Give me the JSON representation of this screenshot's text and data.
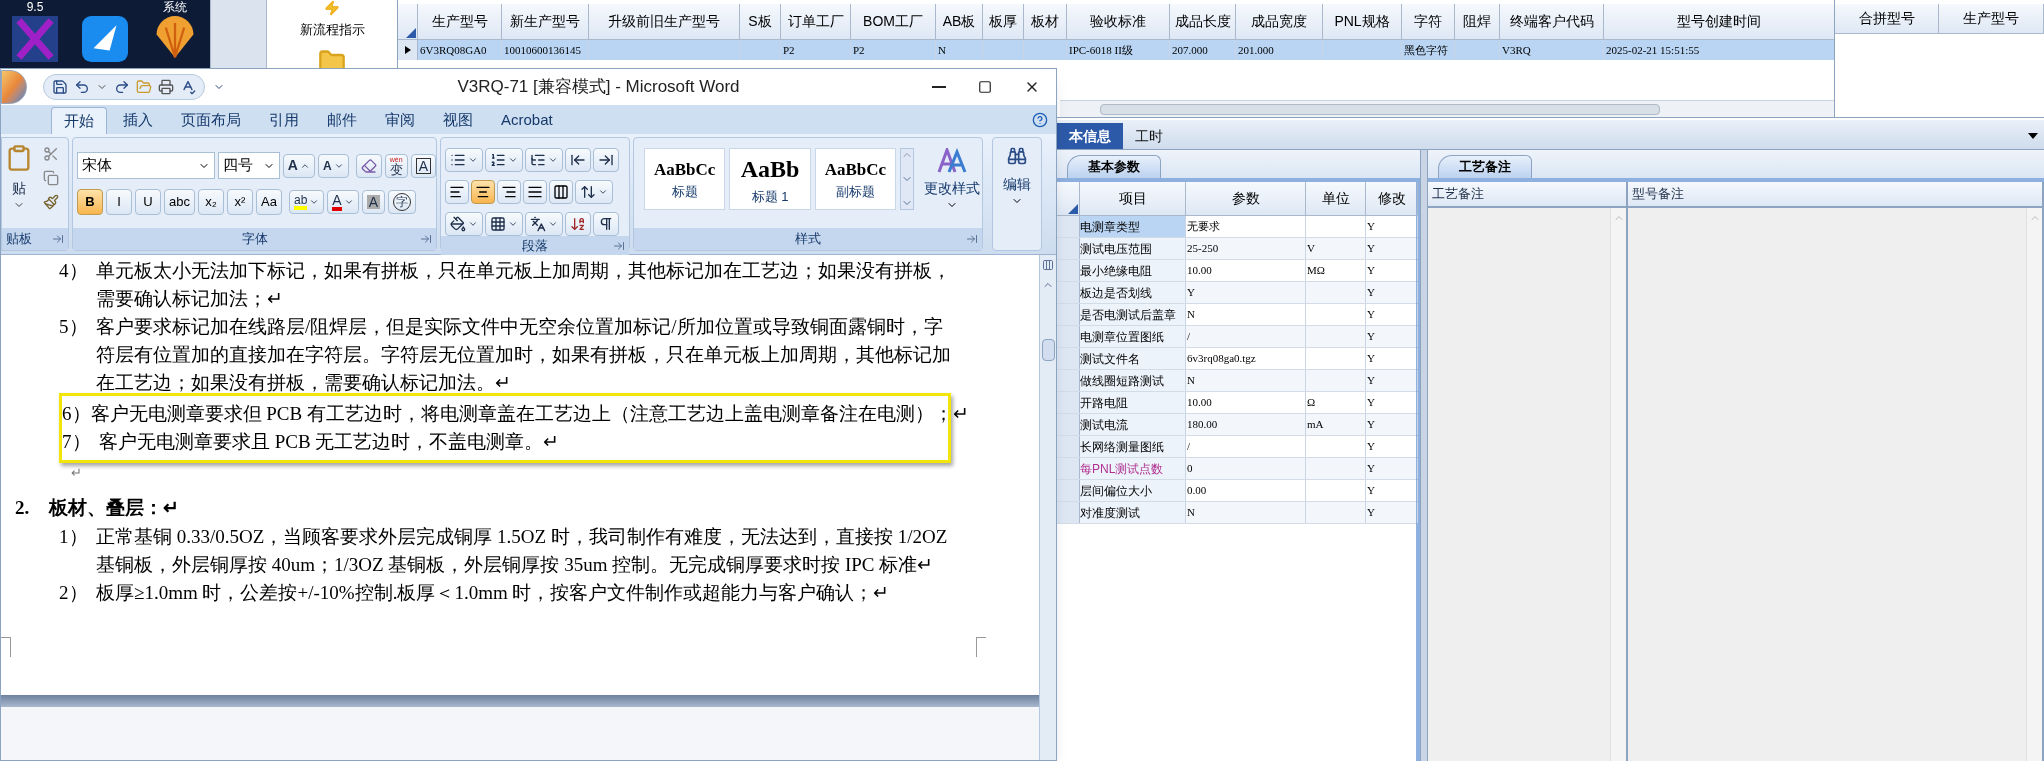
{
  "desktop": {
    "captions": [
      "9.5",
      "系统"
    ]
  },
  "launcher": {
    "label": "新流程指示"
  },
  "product_grid": {
    "columns": [
      "生产型号",
      "新生产型号",
      "升级前旧生产型号",
      "S板",
      "订单工厂",
      "BOM工厂",
      "AB板",
      "板厚",
      "板材",
      "验收标准",
      "成品长度",
      "成品宽度",
      "PNL规格",
      "字符",
      "阻焊",
      "终端客户代码",
      "型号创建时间"
    ],
    "rows": [
      {
        "selected": true,
        "cells": [
          "6V3RQ08GA0",
          "10010600136145",
          null,
          null,
          "P2",
          "P2",
          "N",
          null,
          null,
          "IPC-6018 II级",
          "207.000",
          "201.000",
          null,
          "黑色字符",
          null,
          "V3RQ",
          "2025-02-21 15:51:55"
        ]
      }
    ]
  },
  "merge_grid": {
    "columns": [
      "合拼型号",
      "生产型号"
    ]
  },
  "word": {
    "title": "V3RQ-71 [兼容模式] - Microsoft Word",
    "tabs": [
      {
        "label": "开始",
        "selected": true
      },
      {
        "label": "插入",
        "selected": false
      },
      {
        "label": "页面布局",
        "selected": false
      },
      {
        "label": "引用",
        "selected": false
      },
      {
        "label": "邮件",
        "selected": false
      },
      {
        "label": "审阅",
        "selected": false
      },
      {
        "label": "视图",
        "selected": false
      },
      {
        "label": "Acrobat",
        "selected": false
      }
    ],
    "clipboard": {
      "paste": "贴",
      "label": "贴板"
    },
    "font": {
      "name": "宋体",
      "size": "四号",
      "label": "字体",
      "grow": "A",
      "shrink": "A",
      "phonetic": "wén",
      "phonetic_char": "变",
      "border_char": "A",
      "format": [
        {
          "label": "B",
          "selected": true
        },
        {
          "label": "I",
          "selected": false
        },
        {
          "label": "U",
          "selected": false
        },
        {
          "label": "abc",
          "selected": false
        },
        {
          "label": "x₂",
          "selected": false
        },
        {
          "label": "x²",
          "selected": false
        },
        {
          "label": "Aa",
          "selected": false
        }
      ],
      "highlight": "ab",
      "font_color": "A",
      "shading": "A",
      "enclosed": "字"
    },
    "paragraph": {
      "label": "段落",
      "alignment": [
        {
          "kind": "left",
          "selected": false
        },
        {
          "kind": "center",
          "selected": true
        },
        {
          "kind": "right",
          "selected": false
        },
        {
          "kind": "justify",
          "selected": false
        },
        {
          "kind": "distributed",
          "selected": false
        }
      ]
    },
    "styles": {
      "label": "样式",
      "items": [
        {
          "sample": "AaBbCc",
          "name": "标题"
        },
        {
          "sample": "AaBb",
          "name": "标题 1"
        },
        {
          "sample": "AaBbCc",
          "name": "副标题"
        }
      ],
      "change": "更改样式"
    },
    "editing": {
      "label": "编辑"
    },
    "document": [
      {
        "kind": "item",
        "number": "4）",
        "framed": false,
        "lines": [
          "单元板太小无法加下标记，如果有拼板，只在单元板上加周期，其他标记加在工艺边；如果没有拼板，",
          "需要确认标记加法；↵"
        ]
      },
      {
        "kind": "item",
        "number": "5）",
        "framed": false,
        "lines": [
          "客户要求标记加在线路层/阻焊层，但是实际文件中无空余位置加标记/所加位置或导致铜面露铜时，字",
          "符层有位置加的直接加在字符层。字符层无位置加时，如果有拼板，只在单元板上加周期，其他标记加",
          "在工艺边；如果没有拼板，需要确认标记加法。↵"
        ]
      },
      {
        "kind": "item",
        "number": "6）",
        "framed": true,
        "lines": [
          "客户无电测章要求但 PCB 有工艺边时，将电测章盖在工艺边上（注意工艺边上盖电测章备注在电测）；↵"
        ]
      },
      {
        "kind": "item",
        "number": "7）",
        "framed": true,
        "lines": [
          "客户无电测章要求且 PCB 无工艺边时，不盖电测章。↵"
        ]
      },
      {
        "kind": "blank",
        "text": "↵"
      },
      {
        "kind": "heading",
        "number": "2.",
        "text": "板材、叠层：↵"
      },
      {
        "kind": "item",
        "number": "1）",
        "framed": false,
        "lines": [
          "正常基铜 0.33/0.5OZ，当顾客要求外层完成铜厚 1.5OZ 时，我司制作有难度，无法达到，直接按 1/2OZ",
          "基铜板，外层铜厚按 40um；1/3OZ 基铜板，外层铜厚按 35um 控制。无完成铜厚要求时按 IPC 标准↵"
        ]
      },
      {
        "kind": "item",
        "number": "2）",
        "framed": false,
        "lines": [
          "板厚≥1.0mm 时，公差按+/-10%控制.板厚＜1.0mm 时，按客户文件制作或超能力与客户确认；↵"
        ]
      }
    ]
  },
  "detail_tabs": [
    {
      "label": "本信息",
      "selected": true
    },
    {
      "label": "工时",
      "selected": false
    }
  ],
  "params_panel": {
    "tab": "基本参数",
    "columns": [
      "项目",
      "参数",
      "单位",
      "修改"
    ],
    "rows": [
      {
        "item": "电测章类型",
        "value": "无要求",
        "modify": "Y",
        "selected": true,
        "flagged": false
      },
      {
        "item": "测试电压范围",
        "value": "25-250",
        "unit": "V",
        "modify": "Y",
        "selected": false,
        "flagged": false
      },
      {
        "item": "最小绝缘电阻",
        "value": "10.00",
        "unit": "MΩ",
        "modify": "Y",
        "selected": false,
        "flagged": false
      },
      {
        "item": "板边是否划线",
        "value": "Y",
        "modify": "Y",
        "selected": false,
        "flagged": false
      },
      {
        "item": "是否电测试后盖章",
        "value": "N",
        "modify": "Y",
        "selected": false,
        "flagged": false
      },
      {
        "item": "电测章位置图纸",
        "value": "/",
        "modify": "Y",
        "selected": false,
        "flagged": false
      },
      {
        "item": "测试文件名",
        "value": "6v3rq08ga0.tgz",
        "modify": "Y",
        "selected": false,
        "flagged": false
      },
      {
        "item": "做线圈短路测试",
        "value": "N",
        "modify": "Y",
        "selected": false,
        "flagged": false
      },
      {
        "item": "开路电阻",
        "value": "10.00",
        "unit": "Ω",
        "modify": "Y",
        "selected": false,
        "flagged": false
      },
      {
        "item": "测试电流",
        "value": "180.00",
        "unit": "mA",
        "modify": "Y",
        "selected": false,
        "flagged": false
      },
      {
        "item": "长网络测量图纸",
        "value": "/",
        "modify": "Y",
        "selected": false,
        "flagged": false
      },
      {
        "item": "每PNL测试点数",
        "value": "0",
        "modify": "Y",
        "selected": false,
        "flagged": true
      },
      {
        "item": "层间偏位大小",
        "value": "0.00",
        "modify": "Y",
        "selected": false,
        "flagged": false
      },
      {
        "item": "对准度测试",
        "value": "N",
        "modify": "Y",
        "selected": false,
        "flagged": false
      }
    ]
  },
  "notes_panel": {
    "tab": "工艺备注",
    "columns": [
      "工艺备注",
      "型号备注"
    ]
  }
}
